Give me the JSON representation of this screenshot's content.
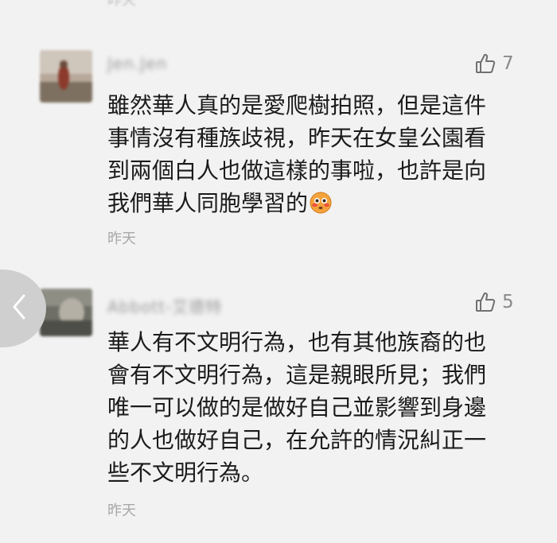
{
  "top_timestamp": "昨天",
  "comments": [
    {
      "username": "Jen.Jen",
      "like_count": "7",
      "text_lines": [
        "雖然華人真的是愛爬樹拍照，但是這件",
        "事情沒有種族歧視，昨天在女皇公園看",
        "到兩個白人也做這樣的事啦，也許是向",
        "我們華人同胞學習的"
      ],
      "emoji": "flushed-face-emoji",
      "timestamp": "昨天"
    },
    {
      "username": "Abbott-艾德特",
      "like_count": "5",
      "text_lines": [
        "華人有不文明行為，也有其他族裔的也",
        "會有不文明行為，這是親眼所見；我們",
        "唯一可以做的是做好自己並影響到身邊",
        "的人也做好自己，在允許的情況糾正一",
        "些不文明行為。"
      ],
      "timestamp": "昨天"
    }
  ],
  "icons": {
    "like": "thumbs-up-icon",
    "back": "chevron-left-icon"
  },
  "colors": {
    "background": "#f2f2f2",
    "text": "#1b1b1b",
    "meta": "#a8a8a8",
    "back_handle": "#cfcfcf"
  }
}
